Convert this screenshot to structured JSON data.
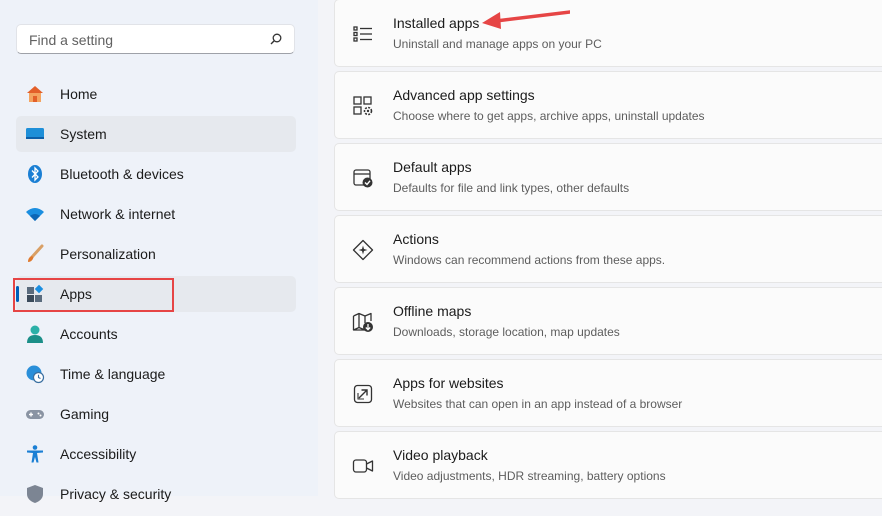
{
  "search": {
    "placeholder": "Find a setting"
  },
  "sidebar": {
    "items": [
      {
        "label": "Home"
      },
      {
        "label": "System"
      },
      {
        "label": "Bluetooth & devices"
      },
      {
        "label": "Network & internet"
      },
      {
        "label": "Personalization"
      },
      {
        "label": "Apps"
      },
      {
        "label": "Accounts"
      },
      {
        "label": "Time & language"
      },
      {
        "label": "Gaming"
      },
      {
        "label": "Accessibility"
      },
      {
        "label": "Privacy & security"
      }
    ]
  },
  "main": {
    "cards": [
      {
        "title": "Installed apps",
        "description": "Uninstall and manage apps on your PC",
        "icon": "list-icon"
      },
      {
        "title": "Advanced app settings",
        "description": "Choose where to get apps, archive apps, uninstall updates",
        "icon": "apps-gear-icon"
      },
      {
        "title": "Default apps",
        "description": "Defaults for file and link types, other defaults",
        "icon": "default-apps-icon"
      },
      {
        "title": "Actions",
        "description": "Windows can recommend actions from these apps.",
        "icon": "actions-icon"
      },
      {
        "title": "Offline maps",
        "description": "Downloads, storage location, map updates",
        "icon": "map-download-icon"
      },
      {
        "title": "Apps for websites",
        "description": "Websites that can open in an app instead of a browser",
        "icon": "open-external-icon"
      },
      {
        "title": "Video playback",
        "description": "Video adjustments, HDR streaming, battery options",
        "icon": "video-icon"
      }
    ]
  },
  "colors": {
    "accent": "#005fb8",
    "highlight": "#e64545"
  }
}
